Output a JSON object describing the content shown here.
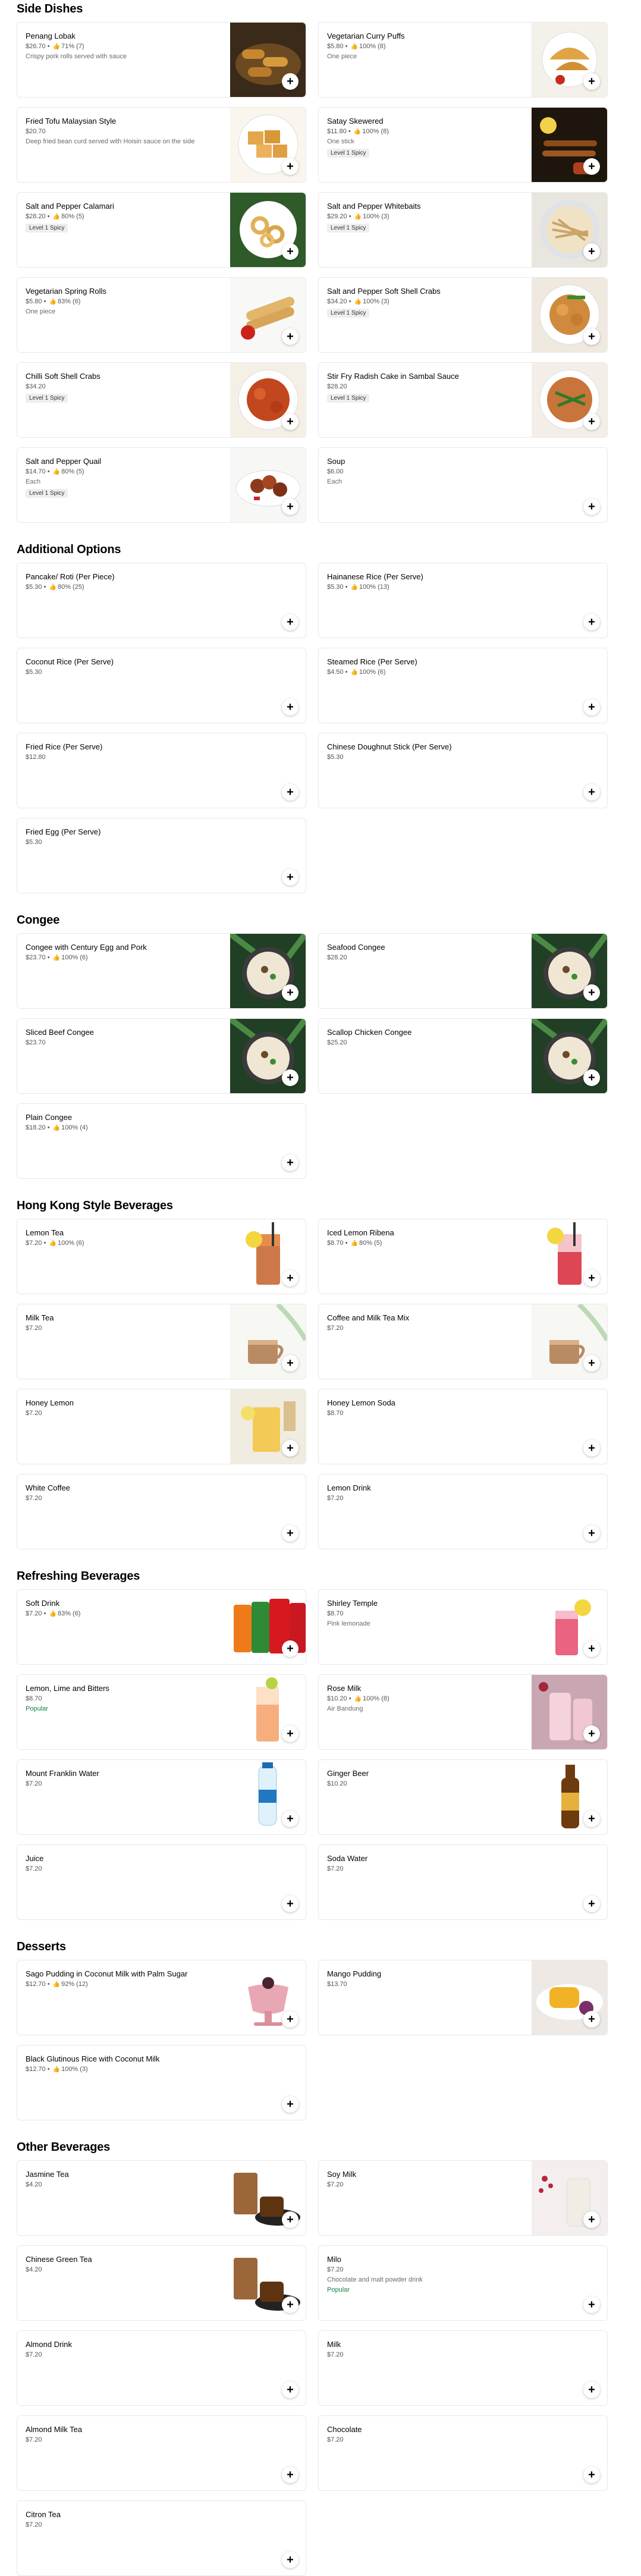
{
  "sections": [
    {
      "title": "Side Dishes",
      "items": [
        {
          "name": "Penang Lobak",
          "price": "$26.70",
          "rating": "71% (7)",
          "desc": "Crispy pork rolls served with sauce",
          "badge": "",
          "popular": "",
          "image": "rolls"
        },
        {
          "name": "Vegetarian Curry Puffs",
          "price": "$5.80",
          "rating": "100% (8)",
          "desc": "One piece",
          "badge": "",
          "popular": "",
          "image": "puffs"
        },
        {
          "name": "Fried Tofu Malaysian Style",
          "price": "$20.70",
          "rating": "",
          "desc": "Deep fried bean curd served with Hoisin sauce on the side",
          "badge": "",
          "popular": "",
          "image": "tofu"
        },
        {
          "name": "Satay Skewered",
          "price": "$11.80",
          "rating": "100% (8)",
          "desc": "One stick",
          "badge": "Level 1 Spicy",
          "popular": "",
          "image": "satay"
        },
        {
          "name": "Salt and Pepper Calamari",
          "price": "$28.20",
          "rating": "80% (5)",
          "desc": "",
          "badge": "Level 1 Spicy",
          "popular": "",
          "image": "calamari"
        },
        {
          "name": "Salt and Pepper Whitebaits",
          "price": "$29.20",
          "rating": "100% (3)",
          "desc": "",
          "badge": "Level 1 Spicy",
          "popular": "",
          "image": "whitebait"
        },
        {
          "name": "Vegetarian Spring Rolls",
          "price": "$5.80",
          "rating": "83% (6)",
          "desc": "One piece",
          "badge": "",
          "popular": "",
          "image": "springrolls"
        },
        {
          "name": "Salt and Pepper Soft Shell Crabs",
          "price": "$34.20",
          "rating": "100% (3)",
          "desc": "",
          "badge": "Level 1 Spicy",
          "popular": "",
          "image": "crab"
        },
        {
          "name": "Chilli Soft Shell Crabs",
          "price": "$34.20",
          "rating": "",
          "desc": "",
          "badge": "Level 1 Spicy",
          "popular": "",
          "image": "chillicrab"
        },
        {
          "name": "Stir Fry Radish Cake in Sambal Sauce",
          "price": "$28.20",
          "rating": "",
          "desc": "",
          "badge": "Level 1 Spicy",
          "popular": "",
          "image": "radish"
        },
        {
          "name": "Salt and Pepper Quail",
          "price": "$14.70",
          "rating": "80% (5)",
          "desc": "Each",
          "badge": "Level 1 Spicy",
          "popular": "",
          "image": "quail"
        },
        {
          "name": "Soup",
          "price": "$6.00",
          "rating": "",
          "desc": "Each",
          "badge": "",
          "popular": "",
          "image": ""
        }
      ]
    },
    {
      "title": "Additional Options",
      "items": [
        {
          "name": "Pancake/ Roti (Per Piece)",
          "price": "$5.30",
          "rating": "80% (25)",
          "desc": "",
          "badge": "",
          "popular": "",
          "image": ""
        },
        {
          "name": "Hainanese Rice (Per Serve)",
          "price": "$5.30",
          "rating": "100% (13)",
          "desc": "",
          "badge": "",
          "popular": "",
          "image": ""
        },
        {
          "name": "Coconut Rice (Per Serve)",
          "price": "$5.30",
          "rating": "",
          "desc": "",
          "badge": "",
          "popular": "",
          "image": ""
        },
        {
          "name": "Steamed Rice (Per Serve)",
          "price": "$4.50",
          "rating": "100% (6)",
          "desc": "",
          "badge": "",
          "popular": "",
          "image": ""
        },
        {
          "name": "Fried Rice (Per Serve)",
          "price": "$12.80",
          "rating": "",
          "desc": "",
          "badge": "",
          "popular": "",
          "image": ""
        },
        {
          "name": "Chinese Doughnut Stick (Per Serve)",
          "price": "$5.30",
          "rating": "",
          "desc": "",
          "badge": "",
          "popular": "",
          "image": ""
        },
        {
          "name": "Fried Egg (Per Serve)",
          "price": "$5.30",
          "rating": "",
          "desc": "",
          "badge": "",
          "popular": "",
          "image": ""
        }
      ]
    },
    {
      "title": "Congee",
      "items": [
        {
          "name": "Congee with Century Egg and Pork",
          "price": "$23.70",
          "rating": "100% (6)",
          "desc": "",
          "badge": "",
          "popular": "",
          "image": "congee"
        },
        {
          "name": "Seafood Congee",
          "price": "$28.20",
          "rating": "",
          "desc": "",
          "badge": "",
          "popular": "",
          "image": "congee"
        },
        {
          "name": "Sliced Beef Congee",
          "price": "$23.70",
          "rating": "",
          "desc": "",
          "badge": "",
          "popular": "",
          "image": "congee"
        },
        {
          "name": "Scallop Chicken Congee",
          "price": "$25.20",
          "rating": "",
          "desc": "",
          "badge": "",
          "popular": "",
          "image": "congee"
        },
        {
          "name": "Plain Congee",
          "price": "$18.20",
          "rating": "100% (4)",
          "desc": "",
          "badge": "",
          "popular": "",
          "image": ""
        }
      ]
    },
    {
      "title": "Hong Kong Style Beverages",
      "items": [
        {
          "name": "Lemon Tea",
          "price": "$7.20",
          "rating": "100% (6)",
          "desc": "",
          "badge": "",
          "popular": "",
          "image": "lemontea"
        },
        {
          "name": "Iced Lemon Ribena",
          "price": "$8.70",
          "rating": "80% (5)",
          "desc": "",
          "badge": "",
          "popular": "",
          "image": "ribena"
        },
        {
          "name": "Milk Tea",
          "price": "$7.20",
          "rating": "",
          "desc": "",
          "badge": "",
          "popular": "",
          "image": "milktea"
        },
        {
          "name": "Coffee and Milk Tea Mix",
          "price": "$7.20",
          "rating": "",
          "desc": "",
          "badge": "",
          "popular": "",
          "image": "milktea"
        },
        {
          "name": "Honey Lemon",
          "price": "$7.20",
          "rating": "",
          "desc": "",
          "badge": "",
          "popular": "",
          "image": "honeylemon"
        },
        {
          "name": "Honey Lemon Soda",
          "price": "$8.70",
          "rating": "",
          "desc": "",
          "badge": "",
          "popular": "",
          "image": ""
        },
        {
          "name": "White Coffee",
          "price": "$7.20",
          "rating": "",
          "desc": "",
          "badge": "",
          "popular": "",
          "image": ""
        },
        {
          "name": "Lemon Drink",
          "price": "$7.20",
          "rating": "",
          "desc": "",
          "badge": "",
          "popular": "",
          "image": ""
        }
      ]
    },
    {
      "title": "Refreshing Beverages",
      "items": [
        {
          "name": "Soft Drink",
          "price": "$7.20",
          "rating": "83% (6)",
          "desc": "",
          "badge": "",
          "popular": "",
          "image": "cans"
        },
        {
          "name": "Shirley Temple",
          "price": "$8.70",
          "rating": "",
          "desc": "Pink lemonade",
          "badge": "",
          "popular": "",
          "image": "shirley"
        },
        {
          "name": "Lemon, Lime and Bitters",
          "price": "$8.70",
          "rating": "",
          "desc": "",
          "badge": "",
          "popular": "Popular",
          "image": "llb"
        },
        {
          "name": "Rose Milk",
          "price": "$10.20",
          "rating": "100% (8)",
          "desc": "Air Bandung",
          "badge": "",
          "popular": "",
          "image": "rosemilk"
        },
        {
          "name": "Mount Franklin Water",
          "price": "$7.20",
          "rating": "",
          "desc": "",
          "badge": "",
          "popular": "",
          "image": "water"
        },
        {
          "name": "Ginger Beer",
          "price": "$10.20",
          "rating": "",
          "desc": "",
          "badge": "",
          "popular": "",
          "image": "gingerbeer"
        },
        {
          "name": "Juice",
          "price": "$7.20",
          "rating": "",
          "desc": "",
          "badge": "",
          "popular": "",
          "image": ""
        },
        {
          "name": "Soda Water",
          "price": "$7.20",
          "rating": "",
          "desc": "",
          "badge": "",
          "popular": "",
          "image": ""
        }
      ]
    },
    {
      "title": "Desserts",
      "items": [
        {
          "name": "Sago Pudding in Coconut Milk with Palm Sugar",
          "price": "$12.70",
          "rating": "92% (12)",
          "desc": "",
          "badge": "",
          "popular": "",
          "image": "sago"
        },
        {
          "name": "Mango Pudding",
          "price": "$13.70",
          "rating": "",
          "desc": "",
          "badge": "",
          "popular": "",
          "image": "mango"
        },
        {
          "name": "Black Glutinous Rice with Coconut Milk",
          "price": "$12.70",
          "rating": "100% (3)",
          "desc": "",
          "badge": "",
          "popular": "",
          "image": ""
        }
      ]
    },
    {
      "title": "Other Beverages",
      "items": [
        {
          "name": "Jasmine Tea",
          "price": "$4.20",
          "rating": "",
          "desc": "",
          "badge": "",
          "popular": "",
          "image": "tea"
        },
        {
          "name": "Soy Milk",
          "price": "$7.20",
          "rating": "",
          "desc": "",
          "badge": "",
          "popular": "",
          "image": "soymilk"
        },
        {
          "name": "Chinese Green Tea",
          "price": "$4.20",
          "rating": "",
          "desc": "",
          "badge": "",
          "popular": "",
          "image": "tea"
        },
        {
          "name": "Milo",
          "price": "$7.20",
          "rating": "",
          "desc": "Chocolate and malt powder drink",
          "badge": "",
          "popular": "Popular",
          "image": ""
        },
        {
          "name": "Almond Drink",
          "price": "$7.20",
          "rating": "",
          "desc": "",
          "badge": "",
          "popular": "",
          "image": ""
        },
        {
          "name": "Milk",
          "price": "$7.20",
          "rating": "",
          "desc": "",
          "badge": "",
          "popular": "",
          "image": ""
        },
        {
          "name": "Almond Milk Tea",
          "price": "$7.20",
          "rating": "",
          "desc": "",
          "badge": "",
          "popular": "",
          "image": ""
        },
        {
          "name": "Chocolate",
          "price": "$7.20",
          "rating": "",
          "desc": "",
          "badge": "",
          "popular": "",
          "image": ""
        },
        {
          "name": "Citron Tea",
          "price": "$7.20",
          "rating": "",
          "desc": "",
          "badge": "",
          "popular": "",
          "image": ""
        }
      ]
    }
  ],
  "icons": {
    "add": "plus-icon",
    "rating": "thumbs-up-icon"
  },
  "colors": {
    "popular": "#0e8345",
    "badge_bg": "#eeeeee",
    "border": "#e8e8e8"
  }
}
